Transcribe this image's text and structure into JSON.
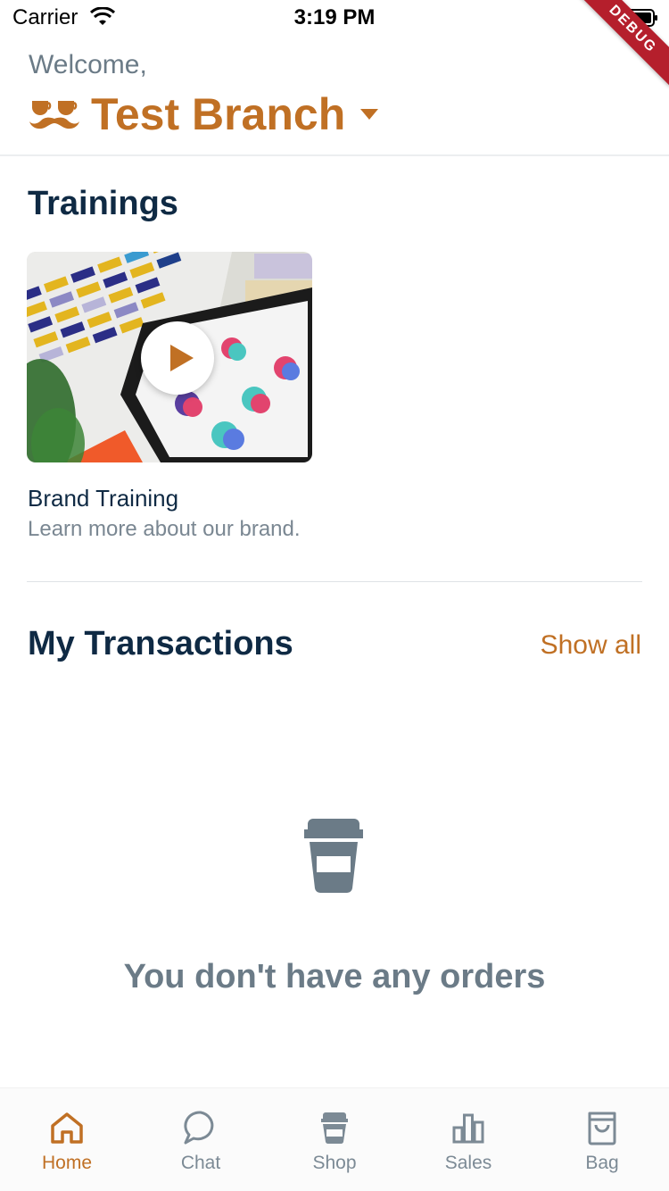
{
  "status_bar": {
    "carrier": "Carrier",
    "time": "3:19 PM",
    "debug_label": "DEBUG"
  },
  "header": {
    "welcome": "Welcome,",
    "branch_name": "Test Branch",
    "logo_icon": "mustache-cups-logo",
    "dropdown_icon": "caret-down-icon"
  },
  "trainings": {
    "title": "Trainings",
    "items": [
      {
        "title": "Brand Training",
        "description": "Learn more about our brand.",
        "thumbnail_icon": "video-thumbnail",
        "play_icon": "play-icon"
      }
    ]
  },
  "transactions": {
    "title": "My Transactions",
    "show_all": "Show all",
    "empty_icon": "coffee-cup-icon",
    "empty_message": "You don't have any orders"
  },
  "bottom_nav": {
    "items": [
      {
        "label": "Home",
        "icon": "home-icon",
        "active": true
      },
      {
        "label": "Chat",
        "icon": "chat-bubble-icon",
        "active": false
      },
      {
        "label": "Shop",
        "icon": "cup-icon",
        "active": false
      },
      {
        "label": "Sales",
        "icon": "bar-chart-icon",
        "active": false
      },
      {
        "label": "Bag",
        "icon": "shopping-bag-icon",
        "active": false
      }
    ]
  },
  "colors": {
    "accent": "#c07024",
    "heading": "#0f2a44",
    "muted": "#6b7b87",
    "inactive_nav": "#7c8a95"
  }
}
